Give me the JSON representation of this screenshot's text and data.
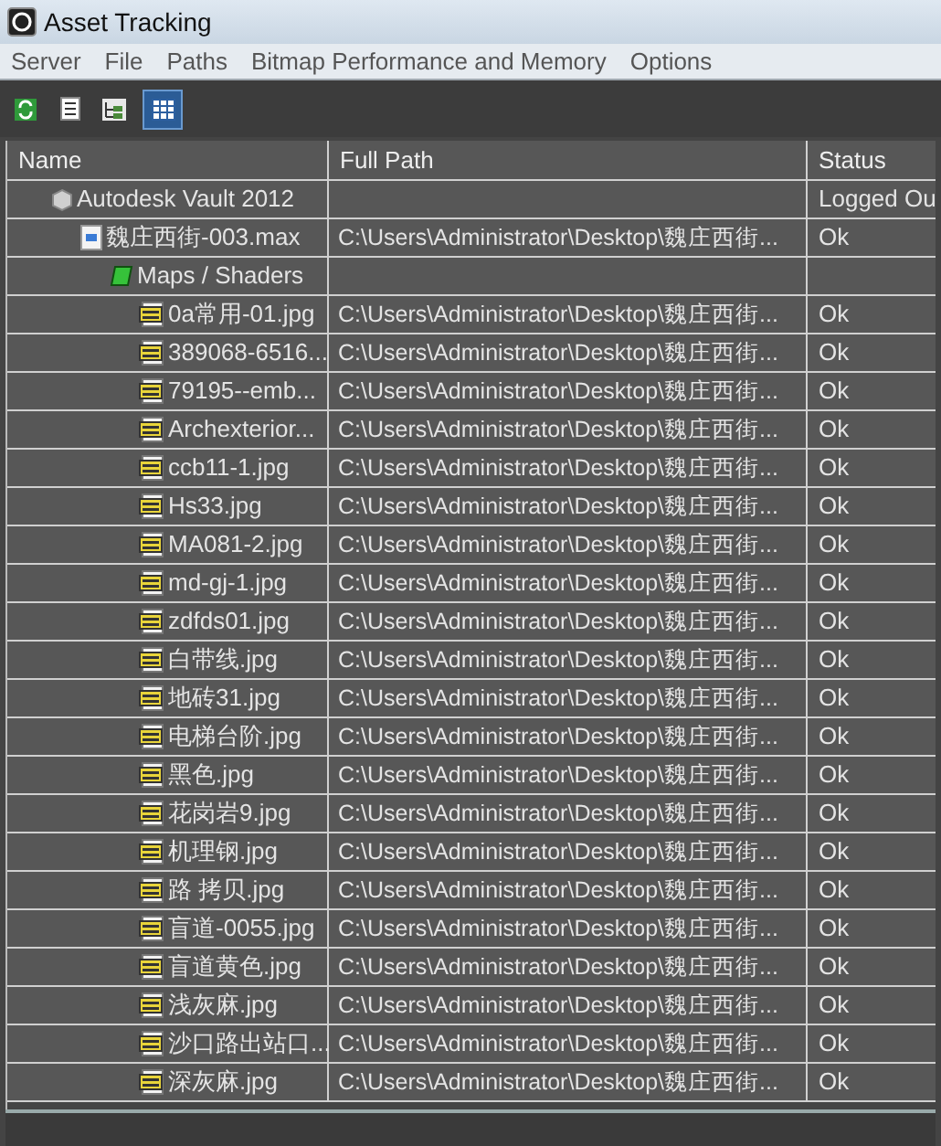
{
  "window": {
    "title": "Asset Tracking"
  },
  "menu": [
    "Server",
    "File",
    "Paths",
    "Bitmap Performance and Memory",
    "Options"
  ],
  "toolbar": [
    {
      "kind": "refresh",
      "selected": false
    },
    {
      "kind": "list",
      "selected": false
    },
    {
      "kind": "tree",
      "selected": false
    },
    {
      "kind": "table",
      "selected": true
    }
  ],
  "table": {
    "columns": [
      "Name",
      "Full Path",
      "Status"
    ],
    "rows": [
      {
        "kind": "vault",
        "name": "Autodesk Vault 2012",
        "status": "Logged Ou",
        "children": [
          {
            "kind": "max",
            "name": "魏庄西街-003.max",
            "full_path": "C:\\Users\\Administrator\\Desktop\\魏庄西街...",
            "status": "Ok",
            "children": [
              {
                "kind": "folder",
                "name": "Maps / Shaders",
                "children": [
                  {
                    "kind": "jpg",
                    "name": "0a常用-01.jpg",
                    "full_path": "C:\\Users\\Administrator\\Desktop\\魏庄西街...",
                    "status": "Ok"
                  },
                  {
                    "kind": "jpg",
                    "name": "389068-6516...",
                    "full_path": "C:\\Users\\Administrator\\Desktop\\魏庄西街...",
                    "status": "Ok"
                  },
                  {
                    "kind": "jpg",
                    "name": "79195--emb...",
                    "full_path": "C:\\Users\\Administrator\\Desktop\\魏庄西街...",
                    "status": "Ok"
                  },
                  {
                    "kind": "jpg",
                    "name": "Archexterior...",
                    "full_path": "C:\\Users\\Administrator\\Desktop\\魏庄西街...",
                    "status": "Ok"
                  },
                  {
                    "kind": "jpg",
                    "name": "ccb11-1.jpg",
                    "full_path": "C:\\Users\\Administrator\\Desktop\\魏庄西街...",
                    "status": "Ok"
                  },
                  {
                    "kind": "jpg",
                    "name": "Hs33.jpg",
                    "full_path": "C:\\Users\\Administrator\\Desktop\\魏庄西街...",
                    "status": "Ok"
                  },
                  {
                    "kind": "jpg",
                    "name": "MA081-2.jpg",
                    "full_path": "C:\\Users\\Administrator\\Desktop\\魏庄西街...",
                    "status": "Ok"
                  },
                  {
                    "kind": "jpg",
                    "name": "md-gj-1.jpg",
                    "full_path": "C:\\Users\\Administrator\\Desktop\\魏庄西街...",
                    "status": "Ok"
                  },
                  {
                    "kind": "jpg",
                    "name": "zdfds01.jpg",
                    "full_path": "C:\\Users\\Administrator\\Desktop\\魏庄西街...",
                    "status": "Ok"
                  },
                  {
                    "kind": "jpg",
                    "name": "白带线.jpg",
                    "full_path": "C:\\Users\\Administrator\\Desktop\\魏庄西街...",
                    "status": "Ok"
                  },
                  {
                    "kind": "jpg",
                    "name": "地砖31.jpg",
                    "full_path": "C:\\Users\\Administrator\\Desktop\\魏庄西街...",
                    "status": "Ok"
                  },
                  {
                    "kind": "jpg",
                    "name": "电梯台阶.jpg",
                    "full_path": "C:\\Users\\Administrator\\Desktop\\魏庄西街...",
                    "status": "Ok"
                  },
                  {
                    "kind": "jpg",
                    "name": "黑色.jpg",
                    "full_path": "C:\\Users\\Administrator\\Desktop\\魏庄西街...",
                    "status": "Ok"
                  },
                  {
                    "kind": "jpg",
                    "name": "花岗岩9.jpg",
                    "full_path": "C:\\Users\\Administrator\\Desktop\\魏庄西街...",
                    "status": "Ok"
                  },
                  {
                    "kind": "jpg",
                    "name": "机理钢.jpg",
                    "full_path": "C:\\Users\\Administrator\\Desktop\\魏庄西街...",
                    "status": "Ok"
                  },
                  {
                    "kind": "jpg",
                    "name": "路 拷贝.jpg",
                    "full_path": "C:\\Users\\Administrator\\Desktop\\魏庄西街...",
                    "status": "Ok"
                  },
                  {
                    "kind": "jpg",
                    "name": "盲道-0055.jpg",
                    "full_path": "C:\\Users\\Administrator\\Desktop\\魏庄西街...",
                    "status": "Ok"
                  },
                  {
                    "kind": "jpg",
                    "name": "盲道黄色.jpg",
                    "full_path": "C:\\Users\\Administrator\\Desktop\\魏庄西街...",
                    "status": "Ok"
                  },
                  {
                    "kind": "jpg",
                    "name": "浅灰麻.jpg",
                    "full_path": "C:\\Users\\Administrator\\Desktop\\魏庄西街...",
                    "status": "Ok"
                  },
                  {
                    "kind": "jpg",
                    "name": "沙口路出站口...",
                    "full_path": "C:\\Users\\Administrator\\Desktop\\魏庄西街...",
                    "status": "Ok"
                  },
                  {
                    "kind": "jpg",
                    "name": "深灰麻.jpg",
                    "full_path": "C:\\Users\\Administrator\\Desktop\\魏庄西街...",
                    "status": "Ok"
                  }
                ]
              }
            ]
          }
        ]
      }
    ]
  }
}
